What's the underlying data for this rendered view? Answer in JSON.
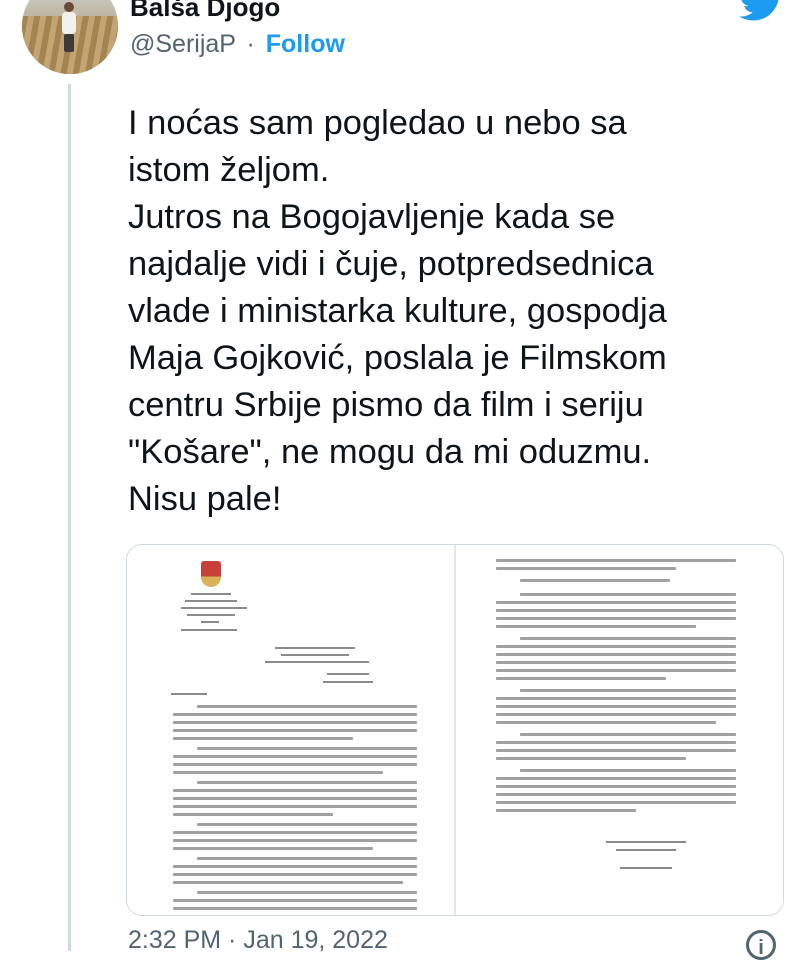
{
  "author": {
    "name": "Balša Djogo",
    "handle": "@SerijaP",
    "separator": "·",
    "follow_label": "Follow"
  },
  "tweet": {
    "text": "I noćas sam pogledao u nebo sa\nistom željom.\nJutros na Bogojavljenje kada se\nnajdalje vidi i čuje, potpredsednica\nvlade i ministarka kulture, gospodja\nMaja Gojković, poslala je Filmskom\ncentru Srbije pismo da film i seriju\n\"Košare\", ne mogu da mi oduzmu.\nNisu pale!",
    "timestamp": "2:32 PM · Jan 19, 2022"
  },
  "icons": {
    "bird": "twitter-bird-icon",
    "info": "info-icon",
    "avatar": "avatar-photo"
  },
  "colors": {
    "accent": "#1d9bf0",
    "text": "#0f1419",
    "secondary": "#536471",
    "border": "#cfd9de"
  }
}
